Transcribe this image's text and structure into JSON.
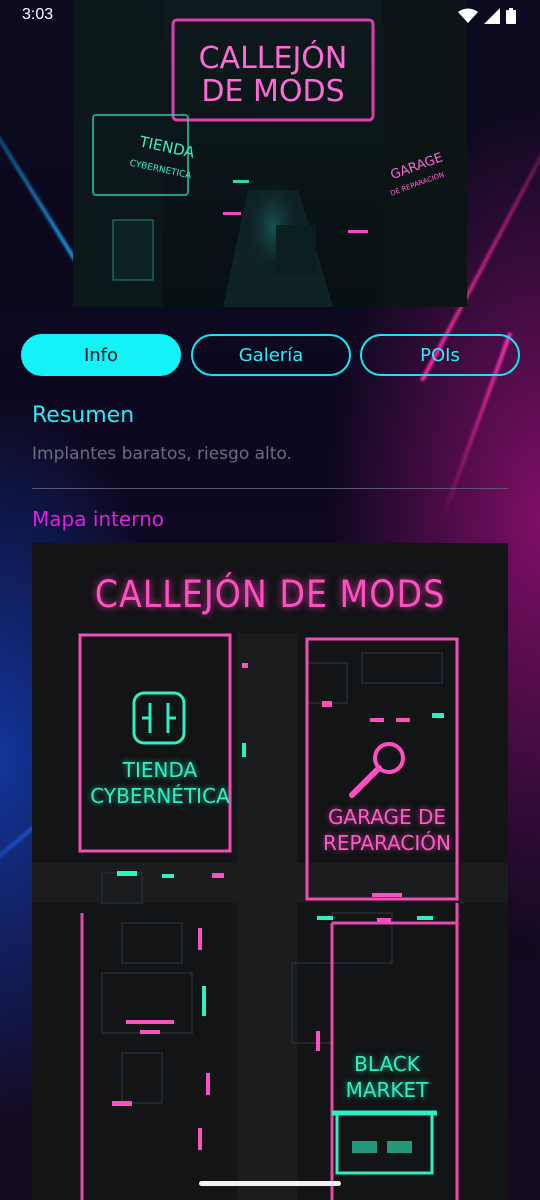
{
  "status_bar": {
    "time": "3:03",
    "icons": [
      "wifi-icon",
      "signal-icon",
      "battery-icon"
    ]
  },
  "hero": {
    "sign_line1": "CALLEJÓN",
    "sign_line2": "DE MODS",
    "left_sign_line1": "TIENDA",
    "left_sign_line2": "CYBERNETICA",
    "right_sign_line1": "GARAGE",
    "right_sign_line2": "DE REPARACION"
  },
  "tabs": [
    {
      "label": "Info",
      "active": true
    },
    {
      "label": "Galería",
      "active": false
    },
    {
      "label": "POIs",
      "active": false
    }
  ],
  "summary": {
    "title": "Resumen",
    "text": "Implantes baratos, riesgo alto."
  },
  "map_section": {
    "title": "Mapa interno",
    "heading": "CALLEJÓN DE MODS",
    "zones": {
      "tienda_line1": "TIENDA",
      "tienda_line2": "CYBERNÉTICA",
      "garage_line1": "GARAGE DE",
      "garage_line2": "REPARACIÓN",
      "black_line1": "BLACK",
      "black_line2": "MARKET"
    }
  },
  "colors": {
    "accent_cyan": "#12f2f7",
    "accent_magenta": "#e21ee0",
    "neon_pink": "#ff4fc0",
    "neon_green": "#2ff0c2"
  }
}
